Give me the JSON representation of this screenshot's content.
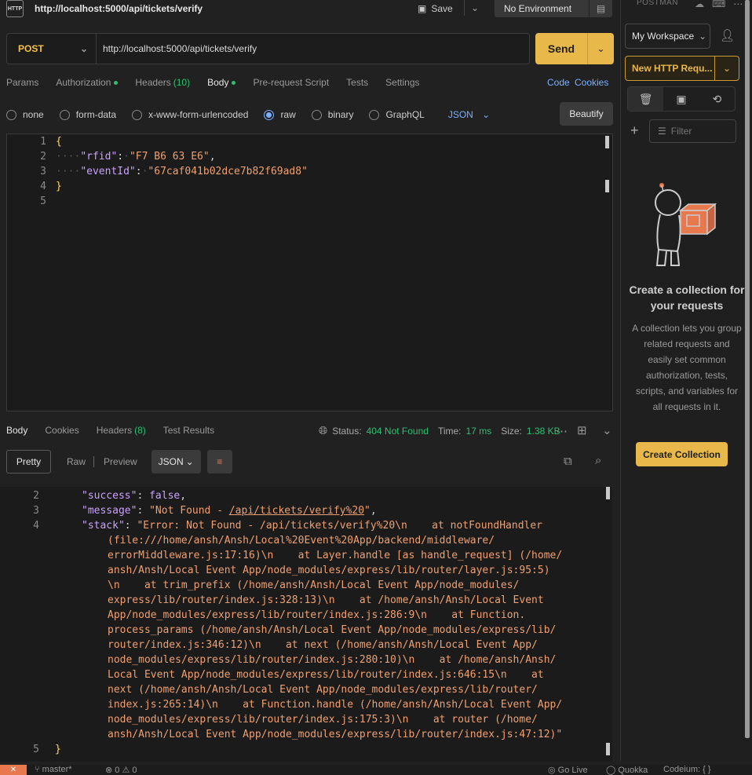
{
  "titlebar": {
    "app_icon": "HTTP",
    "title": "http://localhost:5000/api/tickets/verify",
    "save_label": "Save",
    "environment": "No Environment"
  },
  "request": {
    "method": "POST",
    "url": "http://localhost:5000/api/tickets/verify",
    "send_label": "Send",
    "tabs": [
      {
        "label": "Params"
      },
      {
        "label": "Authorization",
        "dot": true
      },
      {
        "label": "Headers",
        "count": "(10)"
      },
      {
        "label": "Body",
        "dot": true,
        "active": true
      },
      {
        "label": "Pre-request Script"
      },
      {
        "label": "Tests"
      },
      {
        "label": "Settings"
      }
    ],
    "code_link": "Code",
    "cookies_link": "Cookies",
    "body_types": [
      "none",
      "form-data",
      "x-www-form-urlencoded",
      "raw",
      "binary",
      "GraphQL"
    ],
    "body_type_selected": "raw",
    "body_format": "JSON",
    "beautify_label": "Beautify",
    "body_lines": [
      {
        "num": "1",
        "text": "{"
      },
      {
        "num": "2",
        "key": "\"rfid\"",
        "value": "\"F7 B6 63 E6\"",
        "trail": ","
      },
      {
        "num": "3",
        "key": "\"eventId\"",
        "value": "\"67caf041b02dce7b82f69ad8\"",
        "trail": ""
      },
      {
        "num": "4",
        "text": "}"
      },
      {
        "num": "5",
        "text": ""
      }
    ]
  },
  "response": {
    "tabs": [
      {
        "label": "Body",
        "active": true
      },
      {
        "label": "Cookies"
      },
      {
        "label": "Headers",
        "count": "(8)"
      },
      {
        "label": "Test Results"
      }
    ],
    "status_label": "Status:",
    "status_value": "404 Not Found",
    "time_label": "Time:",
    "time_value": "17 ms",
    "size_label": "Size:",
    "size_value": "1.38 KB",
    "view_modes": [
      "Pretty",
      "Raw",
      "Preview"
    ],
    "format": "JSON",
    "line_numbers": [
      "2",
      "3",
      "4",
      "5"
    ],
    "success_line": {
      "key": "\"success\"",
      "value": "false"
    },
    "message_line": {
      "key": "\"message\"",
      "pre": "\"Not Found - ",
      "link": "/api/tickets/verify%20",
      "post": "\""
    },
    "stack_key": "\"stack\"",
    "stack_lines": [
      "\"Error: Not Found - /api/tickets/verify%20\\n    at notFoundHandler",
      "(file:///home/ansh/Ansh/Local%20Event%20App/backend/middleware/",
      "errorMiddleware.js:17:16)\\n    at Layer.handle [as handle_request] (/home/",
      "ansh/Ansh/Local Event App/node_modules/express/lib/router/layer.js:95:5)",
      "\\n    at trim_prefix (/home/ansh/Ansh/Local Event App/node_modules/",
      "express/lib/router/index.js:328:13)\\n    at /home/ansh/Ansh/Local Event",
      "App/node_modules/express/lib/router/index.js:286:9\\n    at Function.",
      "process_params (/home/ansh/Ansh/Local Event App/node_modules/express/lib/",
      "router/index.js:346:12)\\n    at next (/home/ansh/Ansh/Local Event App/",
      "node_modules/express/lib/router/index.js:280:10)\\n    at /home/ansh/Ansh/",
      "Local Event App/node_modules/express/lib/router/index.js:646:15\\n    at",
      "next (/home/ansh/Ansh/Local Event App/node_modules/express/lib/router/",
      "index.js:265:14)\\n    at Function.handle (/home/ansh/Ansh/Local Event App/",
      "node_modules/express/lib/router/index.js:175:3)\\n    at router (/home/",
      "ansh/Ansh/Local Event App/node_modules/express/lib/router/index.js:47:12)\""
    ],
    "closing": "}"
  },
  "sidebar": {
    "brand": "POSTMAN",
    "workspace": "My Workspace",
    "new_request": "New HTTP Requ...",
    "filter_placeholder": "Filter",
    "heading": "Create a collection for your requests",
    "description": "A collection lets you group related requests and easily set common authorization, tests, scripts, and variables for all requests in it.",
    "create_label": "Create Collection"
  },
  "statusbar": {
    "branch": "master*",
    "problems": "⊗ 0 ⚠ 0",
    "golive": "Go Live",
    "quokka": "Quokka",
    "codeium": "Codeium: { }"
  },
  "colors": {
    "accent": "#e8b84a",
    "success": "#2fbf71",
    "link": "#7ab0ff",
    "string": "#f0a070",
    "key": "#c9a0ff"
  }
}
